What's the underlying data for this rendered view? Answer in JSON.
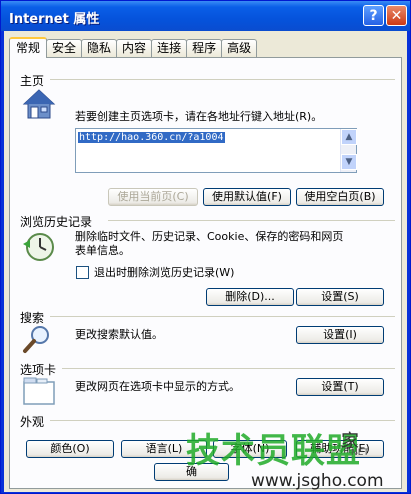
{
  "window": {
    "title": "Internet 属性",
    "help_glyph": "?",
    "close_glyph": "✕"
  },
  "tabs": [
    {
      "label": "常规",
      "active": true
    },
    {
      "label": "安全"
    },
    {
      "label": "隐私"
    },
    {
      "label": "内容"
    },
    {
      "label": "连接"
    },
    {
      "label": "程序"
    },
    {
      "label": "高级"
    }
  ],
  "home": {
    "title": "主页",
    "description": "若要创建主页选项卡，请在各地址行键入地址(R)。",
    "address_value": "http://hao.360.cn/?a1004",
    "buttons": {
      "use_current": "使用当前页(C)",
      "use_default": "使用默认值(F)",
      "use_blank": "使用空白页(B)"
    }
  },
  "history": {
    "title": "浏览历史记录",
    "description_line1": "删除临时文件、历史记录、Cookie、保存的密码和网页",
    "description_line2": "表单信息。",
    "checkbox_label": "退出时删除浏览历史记录(W)",
    "checkbox_checked": false,
    "delete_button": "删除(D)...",
    "settings_button": "设置(S)"
  },
  "search": {
    "title": "搜索",
    "description": "更改搜索默认值。",
    "settings_button": "设置(I)"
  },
  "tabs_section": {
    "title": "选项卡",
    "description": "更改网页在选项卡中显示的方式。",
    "settings_button": "设置(T)"
  },
  "appearance": {
    "title": "外观",
    "buttons": {
      "colors": "颜色(O)",
      "languages": "语言(L)",
      "fonts": "字体(N)",
      "accessibility": "辅助功能(E)"
    }
  },
  "footer": {
    "ok_button_partial": "确"
  },
  "watermark": {
    "main": "技术员联盟",
    "suffix": "家",
    "url": "www.jsgho.com",
    "small": "NET"
  }
}
